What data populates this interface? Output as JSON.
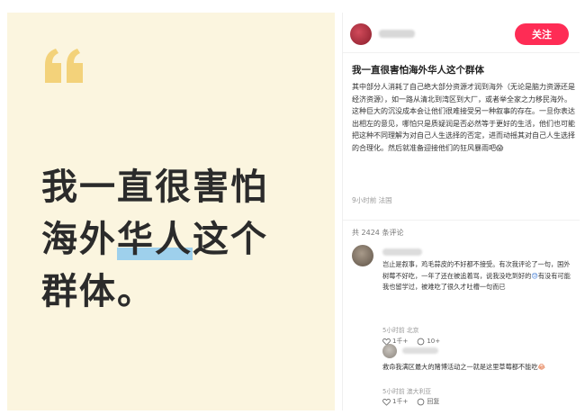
{
  "card": {
    "quote_glyph": "“",
    "headline": {
      "line1": "我一直很害怕",
      "line2_pre": "海外",
      "line2_highlight": "华人",
      "line2_post": "这个",
      "line3": "群体。"
    }
  },
  "note": {
    "follow_label": "关注",
    "title": "我一直很害怕海外华人这个群体",
    "paragraph1": "其中部分人消耗了自己绝大部分资源才润到海外（无论是脑力资源还是经济资源），如一路从清北到湾区到大厂，或者举全家之力移民海外。",
    "paragraph2": "这种巨大的沉没成本会让他们很难接受另一种叙事的存在。一旦你表达出相左的意见，哪怕只是质疑润是否必然等于更好的生活，他们也可能把这种不同理解为对自己人生选择的否定，进而动摇其对自己人生选择的合理化。然后就准备迎接他们的狂风暴雨吧",
    "paragraph2_emoji": "😱",
    "meta": "9小时前 法国",
    "comment_count": "共 2424 条评论"
  },
  "comments": [
    {
      "text": "岂止是叙事，鸡毛蒜皮的不好都不接受。有次我评论了一句，国外树莓不好吃，一年了还在被追着骂，说我没吃到好的",
      "emoji_mid": "😓",
      "text_tail": "有没有可能我也留学过，被难吃了很久才吐槽一句而已",
      "meta": "5小时前 北京",
      "likes": "1千+",
      "replies": "10+"
    },
    {
      "text": "救命我满区最大的赌博活动之一就是这里草莓都不能吃",
      "emoji_tail": "😂",
      "meta": "5小时前 澳大利亚",
      "likes": "1千+",
      "replies": "回复"
    }
  ],
  "colors": {
    "card_bg": "#fbf5df",
    "quote": "#f3d27a",
    "highlight": "#9ed0ec",
    "follow": "#fe2c55"
  }
}
